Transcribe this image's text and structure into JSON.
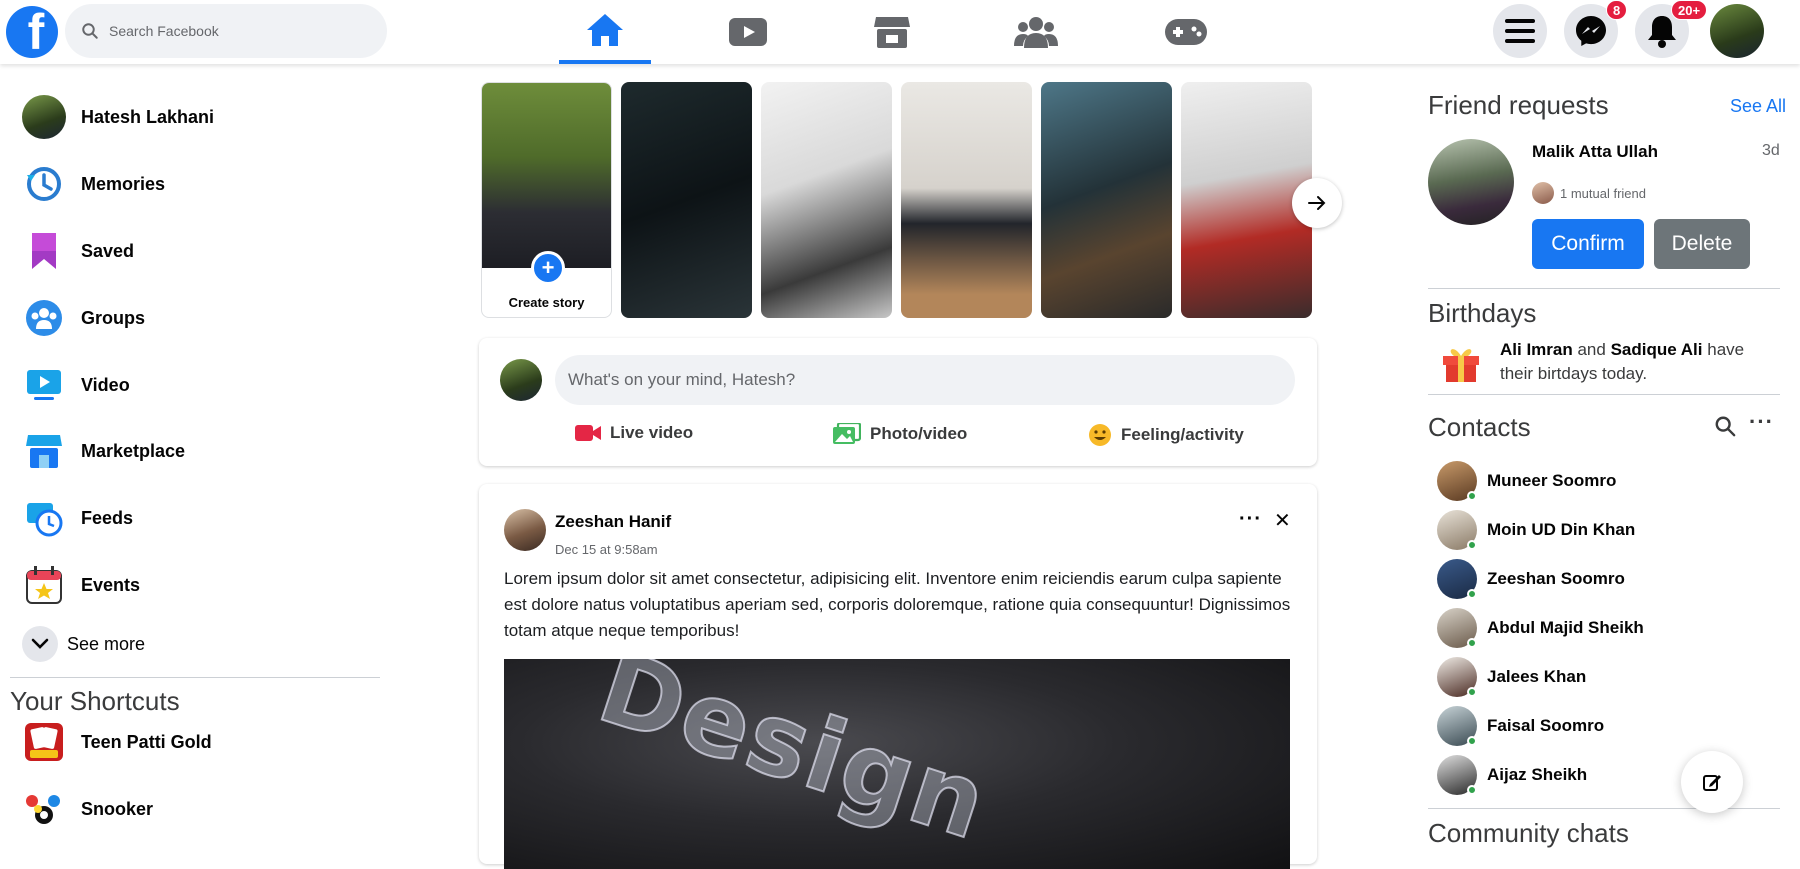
{
  "header": {
    "search_placeholder": "Search Facebook",
    "logo_letter": "f",
    "nav_tabs": [
      "home-icon",
      "video-icon",
      "marketplace-icon",
      "groups-icon",
      "gaming-icon"
    ],
    "messenger_badge": "8",
    "notifications_badge": "20+",
    "accent_color": "#1877f2",
    "badge_color": "#e41e3f"
  },
  "sidebar": {
    "items": [
      {
        "label": "Hatesh Lakhani"
      },
      {
        "label": "Memories"
      },
      {
        "label": "Saved"
      },
      {
        "label": "Groups"
      },
      {
        "label": "Video"
      },
      {
        "label": "Marketplace"
      },
      {
        "label": "Feeds"
      },
      {
        "label": "Events"
      }
    ],
    "see_more": "See more",
    "shortcuts_heading": "Your Shortcuts",
    "shortcuts": [
      {
        "label": "Teen Patti Gold"
      },
      {
        "label": "Snooker"
      }
    ]
  },
  "stories": {
    "create_label": "Create story",
    "plus": "+"
  },
  "composer": {
    "placeholder": "What's on your mind, Hatesh?",
    "actions": [
      {
        "label": "Live video"
      },
      {
        "label": "Photo/video"
      },
      {
        "label": "Feeling/activity"
      }
    ]
  },
  "post": {
    "author": "Zeeshan Hanif",
    "time": "Dec 15 at 9:58am",
    "more": "···",
    "close": "✕",
    "text": "Lorem ipsum dolor sit amet consectetur, adipisicing elit. Inventore enim reiciendis earum culpa sapiente est dolore natus voluptatibus aperiam sed, corporis doloremque, ratione quia consequuntur! Dignissimos totam atque neque temporibus!",
    "image_word": "Design"
  },
  "right": {
    "friend_requests_heading": "Friend requests",
    "see_all": "See All",
    "request": {
      "name": "Malik Atta Ullah",
      "time": "3d",
      "mutual": "1 mutual friend",
      "confirm": "Confirm",
      "delete": "Delete"
    },
    "birthdays_heading": "Birthdays",
    "birthday": {
      "name1": "Ali Imran",
      "and": " and ",
      "name2": "Sadique Ali",
      "rest": " have their birtdays today."
    },
    "contacts_heading": "Contacts",
    "contacts_more": "···",
    "contacts": [
      {
        "name": "Muneer Soomro"
      },
      {
        "name": "Moin UD Din Khan"
      },
      {
        "name": "Zeeshan Soomro"
      },
      {
        "name": "Abdul Majid Sheikh"
      },
      {
        "name": "Jalees Khan"
      },
      {
        "name": "Faisal Soomro"
      },
      {
        "name": "Aijaz Sheikh"
      }
    ],
    "community_heading": "Community chats",
    "online_color": "#31a24c"
  }
}
